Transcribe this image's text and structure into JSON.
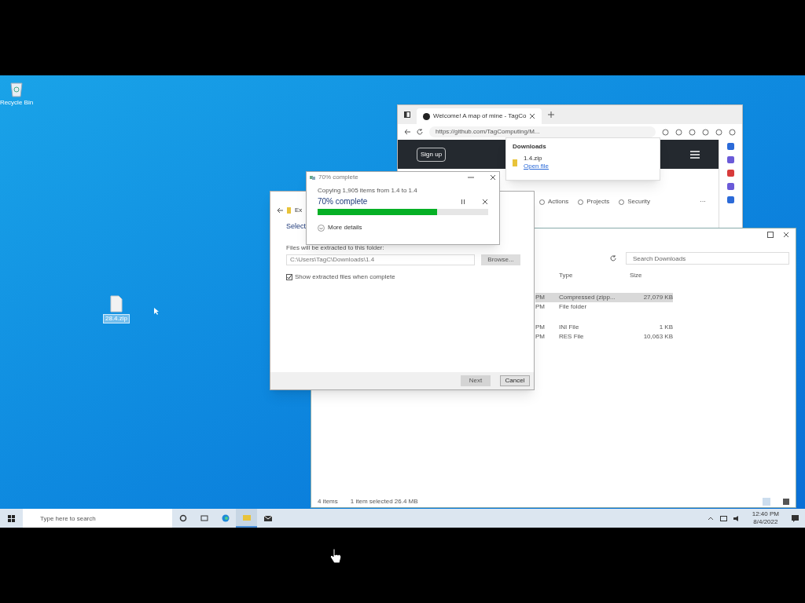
{
  "desktop": {
    "icons": [
      {
        "label": "Recycle Bin",
        "kind": "bin"
      },
      {
        "label": "28.4.zip",
        "kind": "file",
        "selected": true
      }
    ]
  },
  "browser": {
    "tab_title": "Welcome! A map of mine - TagCo",
    "address": "https://github.com/TagComputing/M...",
    "downloads": {
      "title": "Downloads",
      "items": [
        {
          "name": "1.4.zip",
          "action": "Open file"
        }
      ]
    },
    "page": {
      "button": "Sign up",
      "nav": [
        "Actions",
        "Projects",
        "Security"
      ],
      "more": "···"
    }
  },
  "explorer": {
    "search": {
      "placeholder": "Search Downloads"
    },
    "columns": [
      "Type",
      "Size"
    ],
    "groups": [
      {
        "rows": [
          {
            "date": "PM",
            "type": "Compressed (zipp...",
            "size": "27,079 KB",
            "selected": true
          },
          {
            "date": "PM",
            "type": "File folder",
            "size": "",
            "selected": false
          }
        ]
      },
      {
        "rows": [
          {
            "date": "PM",
            "type": "INI File",
            "size": "1 KB",
            "selected": false
          },
          {
            "date": "PM",
            "type": "RES File",
            "size": "10,063 KB",
            "selected": false
          }
        ]
      }
    ],
    "status": [
      "4 items",
      "1 item selected 26.4 MB"
    ]
  },
  "extract": {
    "title": "Ex",
    "heading": "Select",
    "label": "Files will be extracted to this folder:",
    "path": "C:\\Users\\TagC\\Downloads\\1.4",
    "browse": "Browse...",
    "checkbox": {
      "label": "Show extracted files when complete",
      "checked": true
    },
    "buttons": [
      {
        "label": "Next",
        "disabled": true
      },
      {
        "label": "Cancel",
        "disabled": false
      }
    ]
  },
  "progress": {
    "title": "70% complete",
    "summary": "Copying 1,905 items from 1.4 to 1.4",
    "percent": "70% complete",
    "level": 0.7,
    "details": "More details"
  },
  "taskbar": {
    "search": {
      "placeholder": "Type here to search"
    },
    "time": "12:40 PM",
    "date": "8/4/2022"
  }
}
